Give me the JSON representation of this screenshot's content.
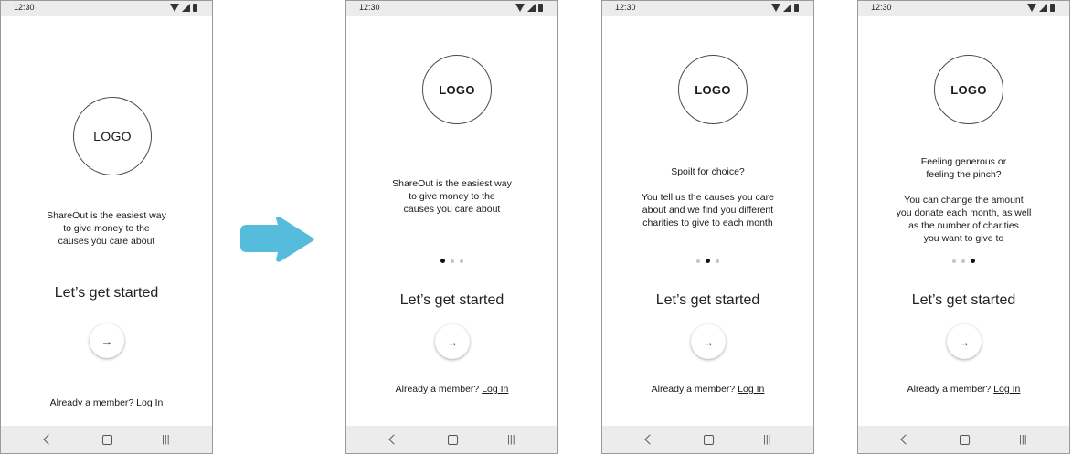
{
  "status_time": "12:30",
  "colors": {
    "flow_arrow": "#55bcdc",
    "bars": "#ececec",
    "active_dot": "#111111",
    "inactive_dot": "#c4c4c4"
  },
  "screens": [
    {
      "logo": "LOGO",
      "lines": [
        "ShareOut is the easiest way",
        "to give money to the",
        "causes you care about"
      ],
      "heading": "Let’s get started",
      "login_prefix": "Already a member? ",
      "login_link": "Log In"
    },
    {
      "logo": "LOGO",
      "lines": [
        "ShareOut is the easiest way",
        "to give money to the",
        "causes you care about"
      ],
      "heading": "Let’s get started",
      "login_prefix": "Already a member? ",
      "login_link": "Log In",
      "active_dot": 1
    },
    {
      "logo": "LOGO",
      "lines": [
        "Spoilt for choice?",
        "",
        "You tell us the causes you care",
        "about and we find you different",
        "charities to give to each month"
      ],
      "heading": "Let’s get started",
      "login_prefix": "Already a member? ",
      "login_link": "Log In",
      "active_dot": 2
    },
    {
      "logo": "LOGO",
      "lines": [
        "Feeling generous or",
        "feeling the pinch?",
        "",
        "You can change the amount",
        "you donate each month, as well",
        "as the number of charities",
        "you want to give to"
      ],
      "heading": "Let’s get started",
      "login_prefix": "Already a member? ",
      "login_link": "Log In",
      "active_dot": 3
    }
  ]
}
